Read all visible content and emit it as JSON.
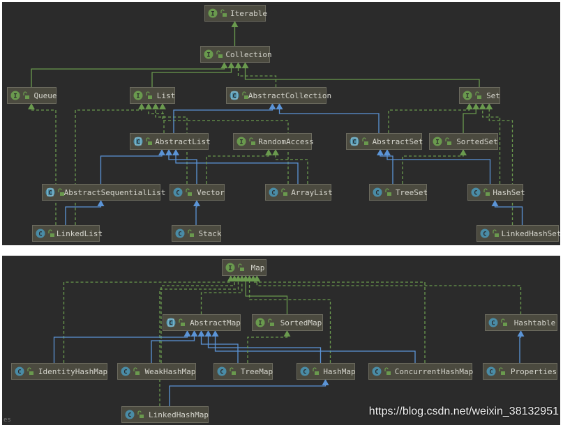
{
  "colors": {
    "background": "#2b2b2b",
    "node_fill": "#4b4a3f",
    "node_border": "#6b6a5e",
    "text": "#d4d4cc",
    "interface": "#6a9a4e",
    "class": "#4a8ca6",
    "extends_class": "#5b94d6",
    "interface_link": "#6a9a4e"
  },
  "diagrams": [
    {
      "nodes": [
        {
          "id": "Iterable",
          "label": "Iterable",
          "kind": "interface"
        },
        {
          "id": "Collection",
          "label": "Collection",
          "kind": "interface"
        },
        {
          "id": "Queue",
          "label": "Queue",
          "kind": "interface"
        },
        {
          "id": "List",
          "label": "List",
          "kind": "interface"
        },
        {
          "id": "AbstractCollection",
          "label": "AbstractCollection",
          "kind": "abstract"
        },
        {
          "id": "Set",
          "label": "Set",
          "kind": "interface"
        },
        {
          "id": "AbstractList",
          "label": "AbstractList",
          "kind": "abstract"
        },
        {
          "id": "RandomAccess",
          "label": "RandomAccess",
          "kind": "interface"
        },
        {
          "id": "AbstractSet",
          "label": "AbstractSet",
          "kind": "abstract"
        },
        {
          "id": "SortedSet",
          "label": "SortedSet",
          "kind": "interface"
        },
        {
          "id": "AbstractSequentialList",
          "label": "AbstractSequentialList",
          "kind": "abstract"
        },
        {
          "id": "Vector",
          "label": "Vector",
          "kind": "class"
        },
        {
          "id": "ArrayList",
          "label": "ArrayList",
          "kind": "class"
        },
        {
          "id": "TreeSet",
          "label": "TreeSet",
          "kind": "class"
        },
        {
          "id": "HashSet",
          "label": "HashSet",
          "kind": "class"
        },
        {
          "id": "LinkedList",
          "label": "LinkedList",
          "kind": "class"
        },
        {
          "id": "Stack",
          "label": "Stack",
          "kind": "class"
        },
        {
          "id": "LinkedHashSet",
          "label": "LinkedHashSet",
          "kind": "class"
        }
      ],
      "edges": [
        {
          "from": "Collection",
          "to": "Iterable",
          "type": "extends-interface"
        },
        {
          "from": "Queue",
          "to": "Collection",
          "type": "extends-interface"
        },
        {
          "from": "List",
          "to": "Collection",
          "type": "extends-interface"
        },
        {
          "from": "AbstractCollection",
          "to": "Collection",
          "type": "implements"
        },
        {
          "from": "Set",
          "to": "Collection",
          "type": "extends-interface"
        },
        {
          "from": "LinkedList",
          "to": "Queue",
          "type": "implements"
        },
        {
          "from": "LinkedList",
          "to": "List",
          "type": "implements"
        },
        {
          "from": "AbstractList",
          "to": "List",
          "type": "implements"
        },
        {
          "from": "Vector",
          "to": "List",
          "type": "implements"
        },
        {
          "from": "ArrayList",
          "to": "List",
          "type": "implements"
        },
        {
          "from": "AbstractList",
          "to": "AbstractCollection",
          "type": "extends-class"
        },
        {
          "from": "AbstractSet",
          "to": "AbstractCollection",
          "type": "extends-class"
        },
        {
          "from": "AbstractSet",
          "to": "Set",
          "type": "implements"
        },
        {
          "from": "SortedSet",
          "to": "Set",
          "type": "extends-interface"
        },
        {
          "from": "HashSet",
          "to": "Set",
          "type": "implements"
        },
        {
          "from": "LinkedHashSet",
          "to": "Set",
          "type": "implements"
        },
        {
          "from": "AbstractSequentialList",
          "to": "AbstractList",
          "type": "extends-class"
        },
        {
          "from": "Vector",
          "to": "AbstractList",
          "type": "extends-class"
        },
        {
          "from": "ArrayList",
          "to": "AbstractList",
          "type": "extends-class"
        },
        {
          "from": "Vector",
          "to": "RandomAccess",
          "type": "implements"
        },
        {
          "from": "ArrayList",
          "to": "RandomAccess",
          "type": "implements"
        },
        {
          "from": "TreeSet",
          "to": "AbstractSet",
          "type": "extends-class"
        },
        {
          "from": "HashSet",
          "to": "AbstractSet",
          "type": "extends-class"
        },
        {
          "from": "TreeSet",
          "to": "SortedSet",
          "type": "implements"
        },
        {
          "from": "LinkedList",
          "to": "AbstractSequentialList",
          "type": "extends-class"
        },
        {
          "from": "Stack",
          "to": "Vector",
          "type": "extends-class"
        },
        {
          "from": "LinkedHashSet",
          "to": "HashSet",
          "type": "extends-class"
        }
      ]
    },
    {
      "nodes": [
        {
          "id": "Map",
          "label": "Map",
          "kind": "interface"
        },
        {
          "id": "AbstractMap",
          "label": "AbstractMap",
          "kind": "abstract"
        },
        {
          "id": "SortedMap",
          "label": "SortedMap",
          "kind": "interface"
        },
        {
          "id": "Hashtable",
          "label": "Hashtable",
          "kind": "class"
        },
        {
          "id": "IdentityHashMap",
          "label": "IdentityHashMap",
          "kind": "class"
        },
        {
          "id": "WeakHashMap",
          "label": "WeakHashMap",
          "kind": "class"
        },
        {
          "id": "TreeMap",
          "label": "TreeMap",
          "kind": "class"
        },
        {
          "id": "HashMap",
          "label": "HashMap",
          "kind": "class"
        },
        {
          "id": "ConcurrentHashMap",
          "label": "ConcurrentHashMap",
          "kind": "class"
        },
        {
          "id": "Properties",
          "label": "Properties",
          "kind": "class"
        },
        {
          "id": "LinkedHashMap",
          "label": "LinkedHashMap",
          "kind": "class"
        }
      ],
      "edges": [
        {
          "from": "LinkedHashMap",
          "to": "Map",
          "type": "implements"
        },
        {
          "from": "IdentityHashMap",
          "to": "Map",
          "type": "implements"
        },
        {
          "from": "WeakHashMap",
          "to": "Map",
          "type": "implements"
        },
        {
          "from": "AbstractMap",
          "to": "Map",
          "type": "implements"
        },
        {
          "from": "SortedMap",
          "to": "Map",
          "type": "extends-interface"
        },
        {
          "from": "HashMap",
          "to": "Map",
          "type": "implements"
        },
        {
          "from": "ConcurrentHashMap",
          "to": "Map",
          "type": "implements"
        },
        {
          "from": "Hashtable",
          "to": "Map",
          "type": "implements"
        },
        {
          "from": "IdentityHashMap",
          "to": "AbstractMap",
          "type": "extends-class"
        },
        {
          "from": "WeakHashMap",
          "to": "AbstractMap",
          "type": "extends-class"
        },
        {
          "from": "TreeMap",
          "to": "AbstractMap",
          "type": "extends-class"
        },
        {
          "from": "HashMap",
          "to": "AbstractMap",
          "type": "extends-class"
        },
        {
          "from": "ConcurrentHashMap",
          "to": "AbstractMap",
          "type": "extends-class"
        },
        {
          "from": "TreeMap",
          "to": "SortedMap",
          "type": "implements"
        },
        {
          "from": "Properties",
          "to": "Hashtable",
          "type": "extends-class"
        },
        {
          "from": "LinkedHashMap",
          "to": "HashMap",
          "type": "extends-class"
        }
      ]
    }
  ],
  "status_text": "es",
  "watermark": "https://blog.csdn.net/weixin_38132951"
}
